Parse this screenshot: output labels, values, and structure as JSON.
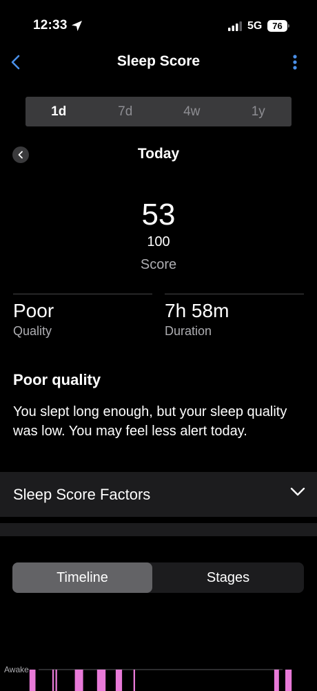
{
  "status_bar": {
    "time": "12:33",
    "network": "5G",
    "battery": "76"
  },
  "nav": {
    "title": "Sleep Score",
    "back_icon": "chevron-left-icon",
    "more_icon": "more-vertical-icon"
  },
  "range_tabs": [
    {
      "label": "1d",
      "active": true
    },
    {
      "label": "7d",
      "active": false
    },
    {
      "label": "4w",
      "active": false
    },
    {
      "label": "1y",
      "active": false
    }
  ],
  "date": {
    "label": "Today"
  },
  "score": {
    "value": "53",
    "max": "100",
    "label": "Score"
  },
  "stats": {
    "quality": {
      "value": "Poor",
      "label": "Quality"
    },
    "duration": {
      "value": "7h 58m",
      "label": "Duration"
    }
  },
  "summary": {
    "title": "Poor quality",
    "text": "You slept long enough, but your sleep quality was low. You may feel less alert today."
  },
  "factors": {
    "label": "Sleep Score Factors"
  },
  "view_toggle": {
    "timeline": "Timeline",
    "stages": "Stages",
    "selected": "Timeline"
  },
  "colors": {
    "accent": "#4a8fe7",
    "awake": "#e87ad8",
    "segment_active": "#636366"
  },
  "chart_data": {
    "type": "timeline",
    "rows": [
      "Awake"
    ],
    "awake_segments": [
      {
        "start": 0.093,
        "end": 0.112
      },
      {
        "start": 0.165,
        "end": 0.17
      },
      {
        "start": 0.175,
        "end": 0.18
      },
      {
        "start": 0.236,
        "end": 0.262
      },
      {
        "start": 0.306,
        "end": 0.333
      },
      {
        "start": 0.365,
        "end": 0.385
      },
      {
        "start": 0.421,
        "end": 0.426
      },
      {
        "start": 0.865,
        "end": 0.88
      },
      {
        "start": 0.9,
        "end": 0.92
      }
    ]
  }
}
